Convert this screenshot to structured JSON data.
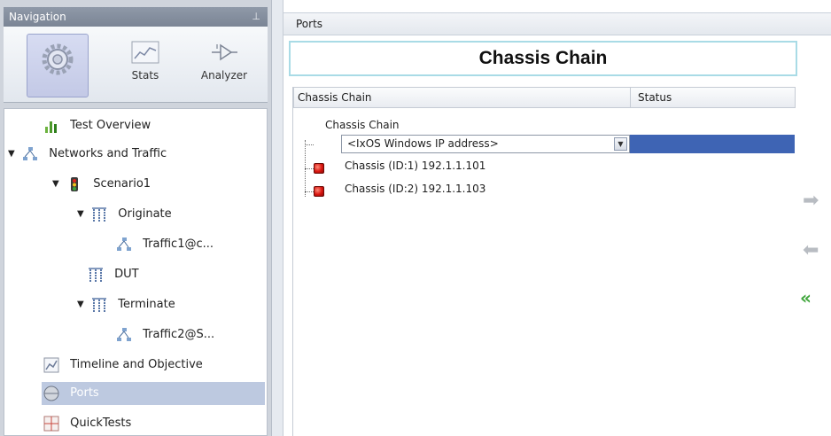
{
  "navigation": {
    "title": "Navigation",
    "pin_glyph": "⊥",
    "buttons": [
      {
        "label": "",
        "icon": "gear-icon"
      },
      {
        "label": "Stats",
        "icon": "chart-icon"
      },
      {
        "label": "Analyzer",
        "icon": "probe-icon"
      }
    ],
    "tree": [
      {
        "label": "Test Overview",
        "icon": "bar-chart-icon",
        "toggle": ""
      },
      {
        "label": "Networks and Traffic",
        "icon": "network-icon",
        "toggle": "▼"
      },
      {
        "label": "Scenario1",
        "icon": "traffic-light-icon",
        "toggle": "▼"
      },
      {
        "label": "Originate",
        "icon": "port-group-icon",
        "toggle": "▼"
      },
      {
        "label": "Traffic1@c...",
        "icon": "network-icon",
        "toggle": ""
      },
      {
        "label": "DUT",
        "icon": "port-group-icon",
        "toggle": ""
      },
      {
        "label": "Terminate",
        "icon": "port-group-icon",
        "toggle": "▼"
      },
      {
        "label": "Traffic2@S...",
        "icon": "network-icon",
        "toggle": ""
      },
      {
        "label": "Timeline and Objective",
        "icon": "timeline-icon",
        "toggle": ""
      },
      {
        "label": "Ports",
        "icon": "port-icon",
        "toggle": ""
      },
      {
        "label": "QuickTests",
        "icon": "quicktests-icon",
        "toggle": ""
      }
    ],
    "selected_item": "Ports"
  },
  "content": {
    "header": "Ports",
    "title": "Chassis Chain",
    "grid": {
      "columns": [
        "Chassis Chain",
        "Status"
      ],
      "root_label": "Chassis Chain",
      "ip_combo": {
        "value": "<IxOS Windows IP address>"
      },
      "chassis": [
        {
          "label": "Chassis (ID:1) 192.1.1.101",
          "status": ""
        },
        {
          "label": "Chassis (ID:2) 192.1.1.103",
          "status": ""
        }
      ]
    }
  },
  "side_arrows": {
    "add_glyph": "➡",
    "remove_glyph": "⬅",
    "remove_all_glyph": "«"
  },
  "colors": {
    "selection": "#3e64b4",
    "nav_selected": "#bdc9e0",
    "title_border": "#a9dbe6",
    "chassis_status": "#d9150f",
    "remove_all_arrow": "#3ea53a"
  }
}
